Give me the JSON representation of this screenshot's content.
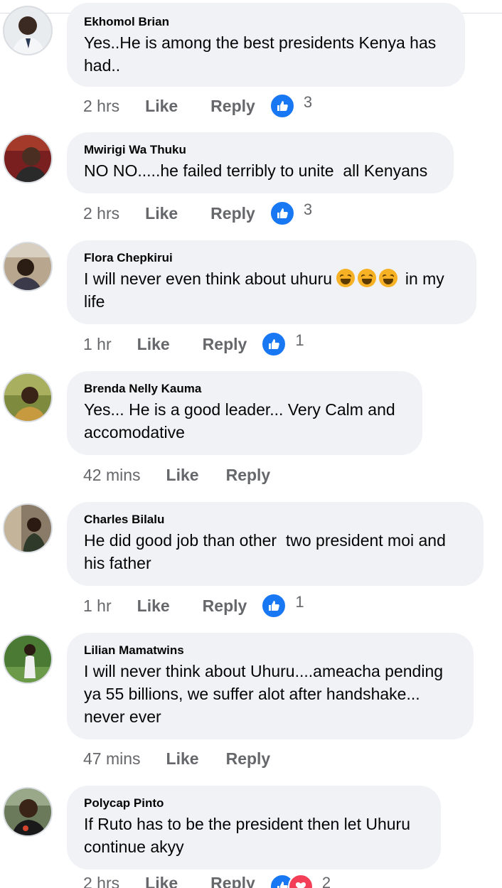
{
  "comments": [
    {
      "author": "Ekhomol Brian",
      "text": "Yes..He is among the best presidents Kenya has had..",
      "time": "2 hrs",
      "like": "Like",
      "reply": "Reply",
      "reaction_count": "3",
      "avatar_color": "#c8d0d8"
    },
    {
      "author": "Mwirigi Wa Thuku",
      "text": "NO NO.....he failed terribly to unite  all Kenyans",
      "time": "2 hrs",
      "like": "Like",
      "reply": "Reply",
      "reaction_count": "3",
      "avatar_color": "#8a2b2b"
    },
    {
      "author": "Flora Chepkirui",
      "text_before": "I will never even think about uhuru ",
      "text_after": " in my life",
      "time": "1 hr",
      "like": "Like",
      "reply": "Reply",
      "reaction_count": "1",
      "avatar_color": "#8c7a66"
    },
    {
      "author": "Brenda Nelly Kauma",
      "text": "Yes... He is a good leader... Very Calm and accomodative",
      "time": "42 mins",
      "like": "Like",
      "reply": "Reply",
      "avatar_color": "#6a7a3a"
    },
    {
      "author": "Charles Bilalu",
      "text": "He did good job than other  two president moi and his father",
      "time": "1 hr",
      "like": "Like",
      "reply": "Reply",
      "reaction_count": "1",
      "avatar_color": "#7a6a5a"
    },
    {
      "author": "Lilian Mamatwins",
      "text": "I will never think about Uhuru....ameacha pending ya 55 billions, we suffer alot after handshake... never ever",
      "time": "47 mins",
      "like": "Like",
      "reply": "Reply",
      "avatar_color": "#4f7a3a"
    },
    {
      "author": "Polycap Pinto",
      "text": "If Ruto has to be the president then let Uhuru continue akyy",
      "time": "2 hrs",
      "like": "Like",
      "reply": "Reply",
      "reaction_count": "2",
      "avatar_color": "#5a6a4a"
    }
  ]
}
